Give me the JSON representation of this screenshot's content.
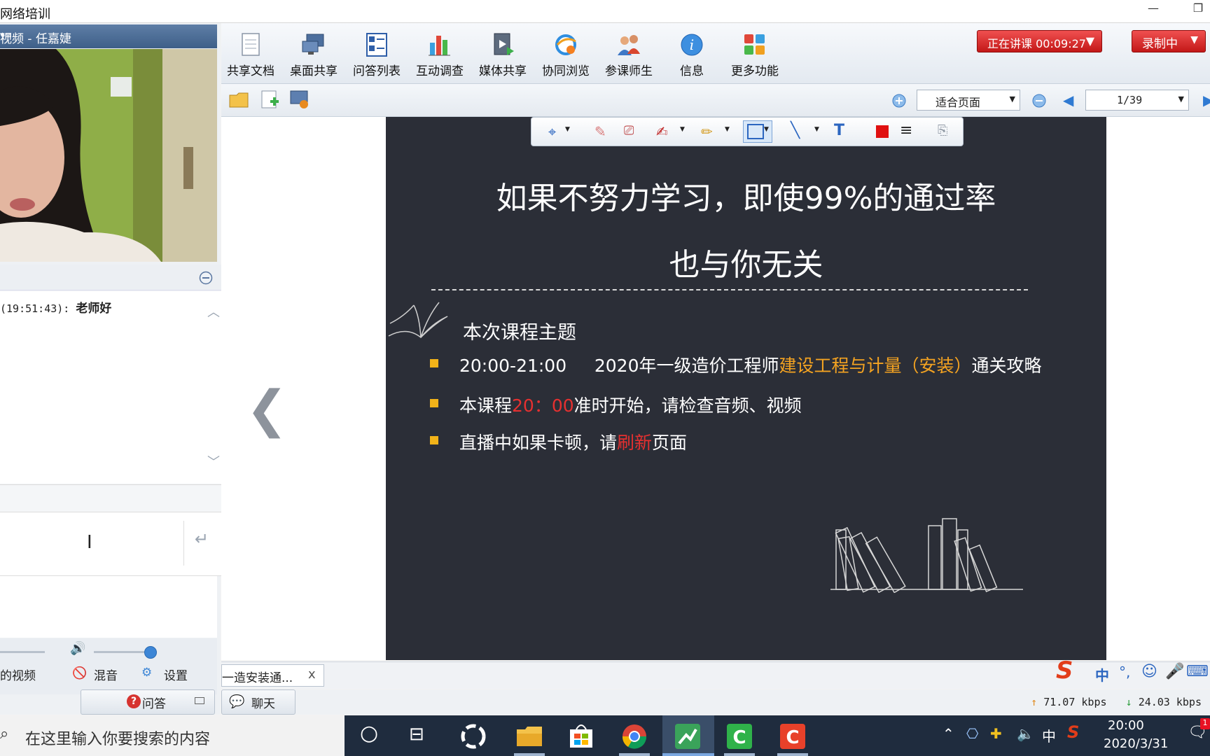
{
  "window": {
    "title": "网络培训",
    "minimize": "—",
    "restore": "❐"
  },
  "video_panel": {
    "title": "视频 - 任嘉婕",
    "menu_icon": "list-menu-icon"
  },
  "chat": {
    "messages": [
      {
        "time": "(19:51:43):",
        "text": "老师好"
      }
    ],
    "collapse_icon": "minus-circle-icon",
    "input_placeholder": "",
    "send_icon": "enter-icon"
  },
  "audio_controls": {
    "video_label": "的视频",
    "mix_label": "混音",
    "settings_label": "设置",
    "volume": 0.65
  },
  "bottom_left_tabs": {
    "qa_label": "问答"
  },
  "toolbar": {
    "items": [
      {
        "label": "共享文档",
        "icon": "document-icon"
      },
      {
        "label": "桌面共享",
        "icon": "desktop-share-icon"
      },
      {
        "label": "问答列表",
        "icon": "qa-list-icon"
      },
      {
        "label": "互动调查",
        "icon": "survey-chart-icon"
      },
      {
        "label": "媒体共享",
        "icon": "media-share-icon"
      },
      {
        "label": "协同浏览",
        "icon": "browser-icon"
      },
      {
        "label": "参课师生",
        "icon": "people-icon"
      },
      {
        "label": "信息",
        "icon": "info-icon"
      },
      {
        "label": "更多功能",
        "icon": "grid-icon"
      }
    ],
    "live_label": "正在讲课 00:09:27",
    "record_label": "录制中"
  },
  "doc_toolbar": {
    "zoom_option": "适合页面",
    "page": "1/39"
  },
  "slide": {
    "title_line1": "如果不努力学习，即使99%的通过率",
    "title_line2": "也与你无关",
    "section": "本次课程主题",
    "bullet1": {
      "time": "20:00-21:00",
      "prefix": "2020年一级造价工程师",
      "highlight": "建设工程与计量（安装）",
      "suffix": "通关攻略"
    },
    "bullet2": {
      "prefix": "本课程",
      "highlight": "20：00",
      "suffix": "准时开始，请检查音频、视频"
    },
    "bullet3": {
      "prefix": "直播中如果卡顿，请",
      "highlight": "刷新",
      "suffix": "页面"
    },
    "prev_arrow": "❮"
  },
  "doc_tab": {
    "label": "一造安装通...",
    "close": "x"
  },
  "chat_tab": {
    "label": "聊天"
  },
  "network": {
    "up": "71.07 kbps",
    "down": "24.03 kbps"
  },
  "ime": {
    "lang": "中"
  },
  "taskbar": {
    "search_placeholder": "在这里输入你要搜索的内容",
    "tray_lang": "中",
    "time": "20:00",
    "date": "2020/3/31",
    "notification_count": "1"
  }
}
